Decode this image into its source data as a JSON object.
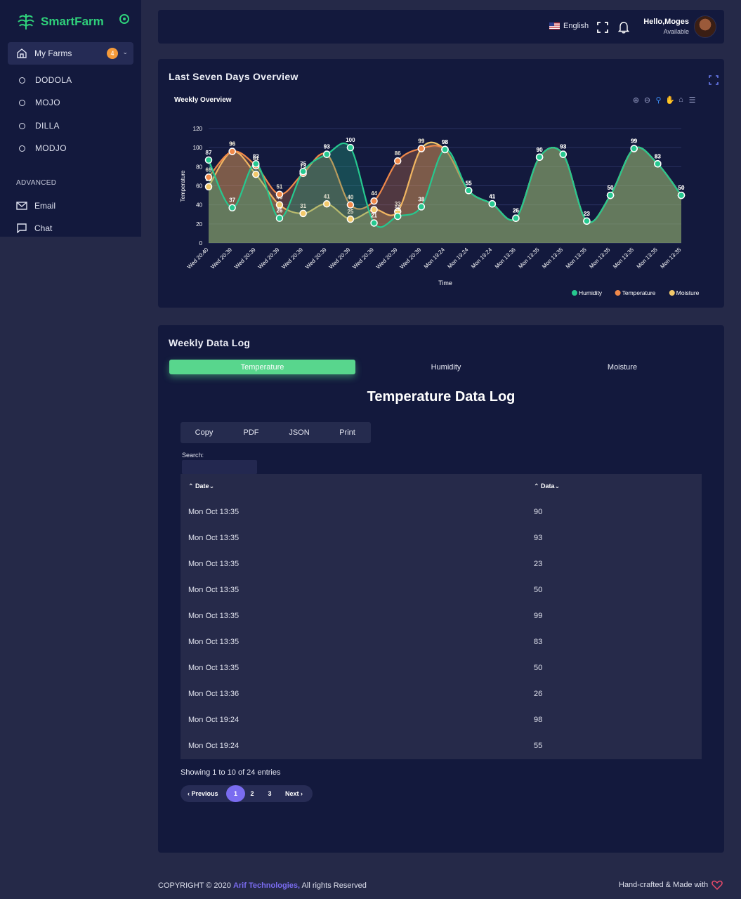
{
  "sidebar": {
    "brand": "SmartFarm",
    "my_farms": {
      "label": "My Farms",
      "badge": "4"
    },
    "farms": [
      "DODOLA",
      "MOJO",
      "DILLA",
      "MODJO"
    ],
    "section_label": "ADVANCED",
    "links": [
      {
        "label": "Email",
        "icon": "mail-icon"
      },
      {
        "label": "Chat",
        "icon": "chat-icon"
      }
    ]
  },
  "header": {
    "language": "English",
    "greeting": "Hello,Moges",
    "status": "Available"
  },
  "overview": {
    "title": "Last Seven Days Overview",
    "chart_title": "Weekly Overview"
  },
  "chart_data": {
    "type": "area",
    "title": "Weekly Overview",
    "xlabel": "Time",
    "ylabel": "Temperature",
    "ylim": [
      0,
      120
    ],
    "yticks": [
      0,
      20,
      40,
      60,
      80,
      100,
      120
    ],
    "categories": [
      "Wed 20:40",
      "Wed 20:39",
      "Wed 20:39",
      "Wed 20:39",
      "Wed 20:39",
      "Wed 20:39",
      "Wed 20:39",
      "Wed 20:39",
      "Wed 20:39",
      "Wed 20:39",
      "Mon 19:24",
      "Mon 19:24",
      "Mon 19:24",
      "Mon 13:36",
      "Mon 13:35",
      "Mon 13:35",
      "Mon 13:35",
      "Mon 13:35",
      "Mon 13:35",
      "Mon 13:35",
      "Mon 13:35"
    ],
    "series": [
      {
        "name": "Humidity",
        "color": "#26c88f",
        "values": [
          87,
          37,
          83,
          26,
          75,
          93,
          100,
          21,
          28,
          38,
          98,
          55,
          41,
          26,
          90,
          93,
          23,
          50,
          99,
          83,
          50
        ]
      },
      {
        "name": "Temperature",
        "color": "#f0894a",
        "values": [
          69,
          96,
          81,
          51,
          73,
          93,
          40,
          44,
          86,
          99,
          98,
          55,
          41,
          26,
          90,
          93,
          23,
          50,
          99,
          83,
          50
        ]
      },
      {
        "name": "Moisture",
        "color": "#f2c86a",
        "values": [
          59,
          96,
          72,
          40,
          31,
          41,
          25,
          35,
          33,
          99,
          98,
          55,
          41,
          26,
          90,
          93,
          23,
          50,
          99,
          83,
          50
        ]
      }
    ],
    "legend_position": "bottom-right",
    "grid": true
  },
  "datalog": {
    "title": "Weekly Data Log",
    "tabs": [
      "Temperature",
      "Humidity",
      "Moisture"
    ],
    "active_tab": "Temperature",
    "heading": "Temperature Data Log",
    "buttons": [
      "Copy",
      "PDF",
      "JSON",
      "Print"
    ],
    "search_label": "Search:",
    "columns": [
      "Date",
      "Data"
    ],
    "rows": [
      [
        "Mon Oct 13:35",
        "90"
      ],
      [
        "Mon Oct 13:35",
        "93"
      ],
      [
        "Mon Oct 13:35",
        "23"
      ],
      [
        "Mon Oct 13:35",
        "50"
      ],
      [
        "Mon Oct 13:35",
        "99"
      ],
      [
        "Mon Oct 13:35",
        "83"
      ],
      [
        "Mon Oct 13:35",
        "50"
      ],
      [
        "Mon Oct 13:36",
        "26"
      ],
      [
        "Mon Oct 19:24",
        "98"
      ],
      [
        "Mon Oct 19:24",
        "55"
      ]
    ],
    "showing": "Showing 1 to 10 of 24 entries",
    "pagination": {
      "prev": "Previous",
      "pages": [
        "1",
        "2",
        "3"
      ],
      "current": "1",
      "next": "Next"
    }
  },
  "footer": {
    "copyright": "COPYRIGHT © 2020",
    "brand": "Arif Technologies,",
    "rights": "All rights Reserved",
    "made_with": "Hand-crafted & Made with"
  }
}
